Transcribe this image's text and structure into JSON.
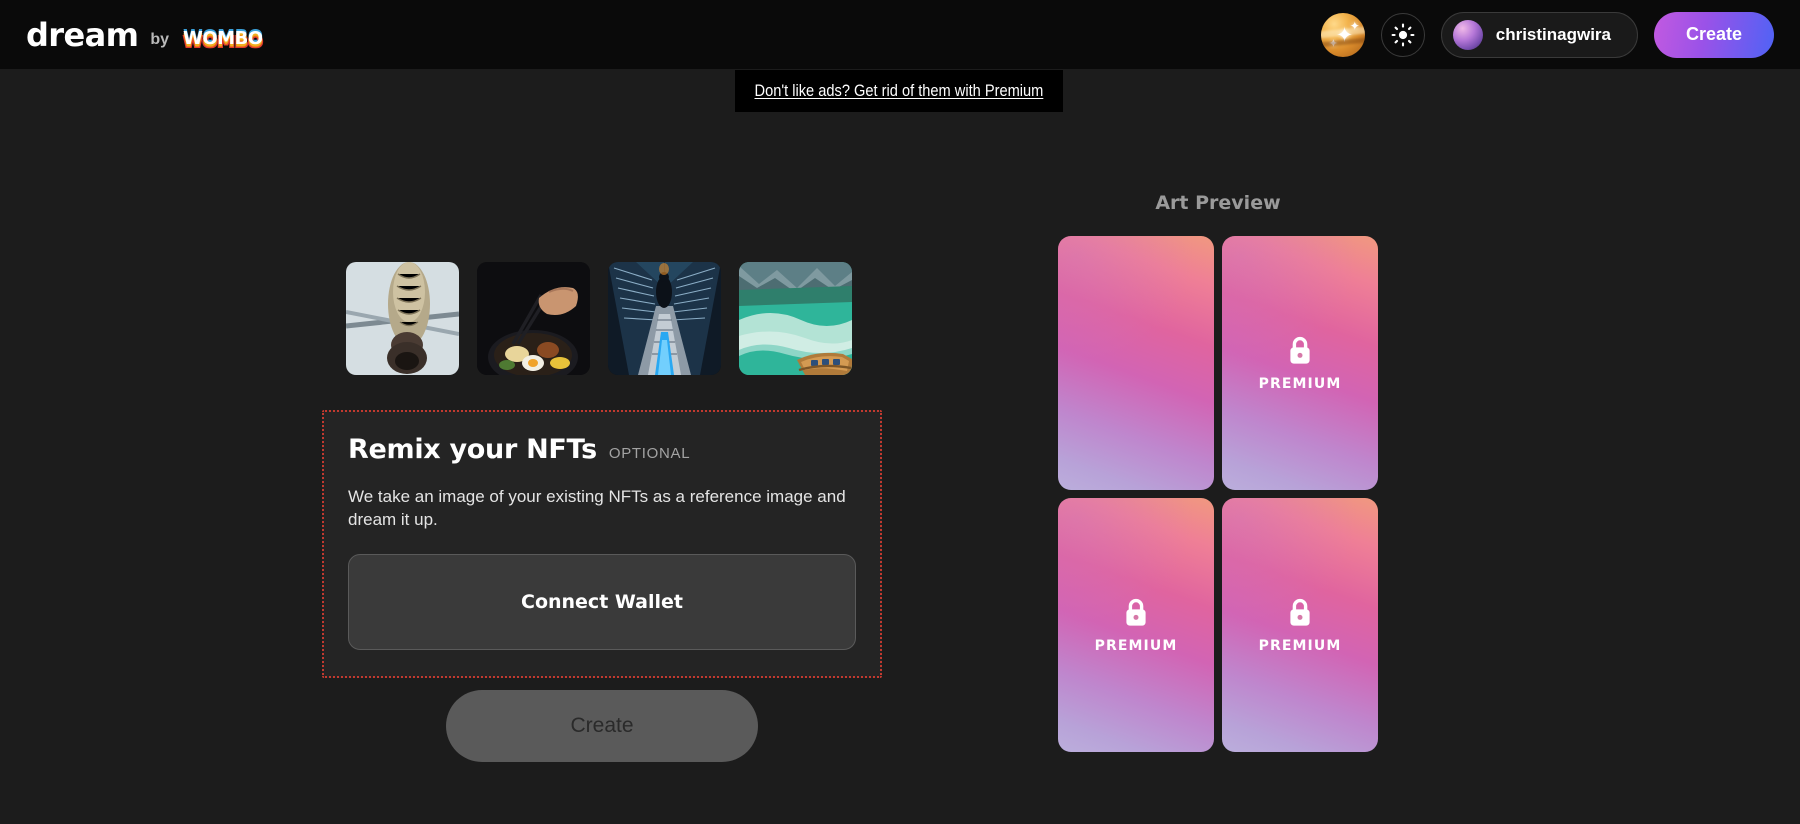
{
  "header": {
    "brand_name": "dream",
    "brand_by": "by",
    "brand_partner": "WOMBO",
    "planet_icon": "planet-sparkle-icon",
    "theme_icon": "sun-icon",
    "username": "christinagwira",
    "avatar_icon": "user-avatar",
    "create_label": "Create",
    "create_gradient_from": "#c25ae0",
    "create_gradient_to": "#4f63f5"
  },
  "ad_banner": {
    "text": "Don't like ads? Get rid of them with Premium",
    "background": "#000000"
  },
  "thumbnails": [
    {
      "name": "bird-on-cable-thumbnail",
      "alt": "Bird perched on a steel cable against pale sky"
    },
    {
      "name": "food-chopsticks-thumbnail",
      "alt": "Hand with chopsticks over a bowl of noodles and egg"
    },
    {
      "name": "escalator-thumbnail",
      "alt": "Person standing on a long escalator in a tunnel"
    },
    {
      "name": "boat-on-lake-thumbnail",
      "alt": "Wooden rowboat on turquoise mountain lake"
    }
  ],
  "nft_section": {
    "title": "Remix your NFTs",
    "optional_tag": "OPTIONAL",
    "description": "We take an image of your existing NFTs as a reference image and dream it up.",
    "connect_wallet_label": "Connect Wallet",
    "highlight_border_color": "#c2392f"
  },
  "create_action": {
    "label": "Create",
    "enabled": false
  },
  "art_preview": {
    "title": "Art Preview",
    "premium_label": "PREMIUM",
    "lock_icon": "lock-icon",
    "cards": [
      {
        "name": "art-preview-card-1",
        "locked": false
      },
      {
        "name": "art-preview-card-2",
        "locked": true
      },
      {
        "name": "art-preview-card-3",
        "locked": true
      },
      {
        "name": "art-preview-card-4",
        "locked": true
      }
    ]
  }
}
